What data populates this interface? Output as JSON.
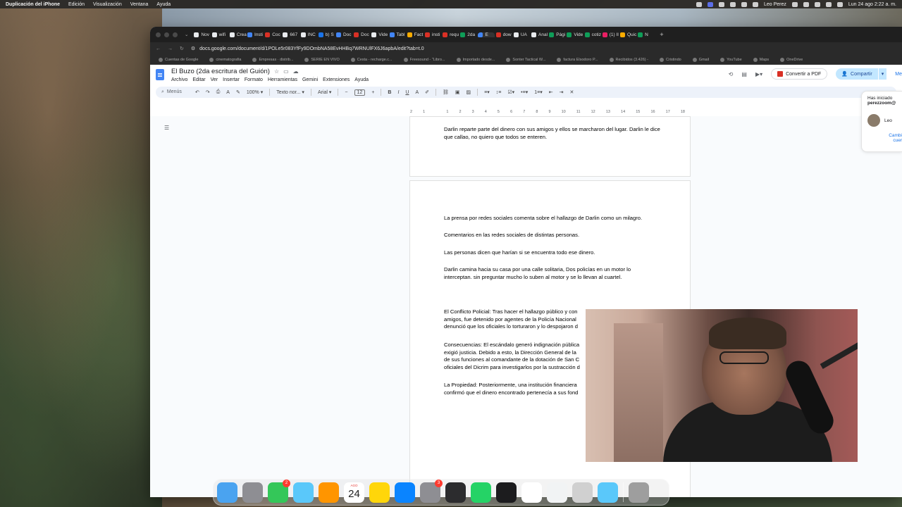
{
  "menubar": {
    "app": "Duplicación del iPhone",
    "items": [
      "Edición",
      "Visualización",
      "Ventana",
      "Ayuda"
    ],
    "user": "Leo Perez",
    "datetime": "Lun 24 ago 2:22 a. m."
  },
  "browser": {
    "tabs": [
      {
        "label": "Nov",
        "color": "#e8eaed"
      },
      {
        "label": "wifi",
        "color": "#e8eaed"
      },
      {
        "label": "Crea",
        "color": "#e8eaed"
      },
      {
        "label": "Insti",
        "color": "#4285f4"
      },
      {
        "label": "Coc",
        "color": "#d93025"
      },
      {
        "label": "667",
        "color": "#e8eaed"
      },
      {
        "label": "INC",
        "color": "#e8eaed"
      },
      {
        "label": "b) S",
        "color": "#1a73e8"
      },
      {
        "label": "Doc",
        "color": "#4285f4"
      },
      {
        "label": "Doc",
        "color": "#d93025"
      },
      {
        "label": "Vide",
        "color": "#e8eaed"
      },
      {
        "label": "Tabl",
        "color": "#4285f4"
      },
      {
        "label": "Fact",
        "color": "#f9ab00"
      },
      {
        "label": "insti",
        "color": "#d93025"
      },
      {
        "label": "requ",
        "color": "#d93025"
      },
      {
        "label": "2da",
        "color": "#0f9d58"
      },
      {
        "label": "E",
        "color": "#4285f4"
      },
      {
        "label": "dow",
        "color": "#d93025"
      },
      {
        "label": "UA",
        "color": "#e8eaed"
      },
      {
        "label": "Anal",
        "color": "#e8eaed"
      },
      {
        "label": "Pági",
        "color": "#0f9d58"
      },
      {
        "label": "Vide",
        "color": "#0f9d58"
      },
      {
        "label": "cotiz",
        "color": "#0f9d58"
      },
      {
        "label": "(1) Il",
        "color": "#e91e63"
      },
      {
        "label": "Quic",
        "color": "#f9ab00"
      },
      {
        "label": "N",
        "color": "#0f9d58"
      }
    ],
    "url": "docs.google.com/document/d/1POLe5r083YfFy9DOmbNA58EvHHBq7WRNUlFX6J6apbA/edit?tab=t.0",
    "bookmarks": [
      "Cuentas de Google",
      "cinematografia",
      "Empresas · distrib...",
      "SERIE EN VIVO",
      "Cesta - recharge.c...",
      "Freesound - \"Libro...",
      "Importado desde...",
      "Sonter Tactical W...",
      "factura Elsodoro P...",
      "Recibidos (3.426) -",
      "Cristindo",
      "Gmail",
      "YouTube",
      "Maps",
      "OneDrive"
    ]
  },
  "docs": {
    "title": "El Buzo (2da escritura del Guión)",
    "menus": [
      "Archivo",
      "Editar",
      "Ver",
      "Insertar",
      "Formato",
      "Herramientas",
      "Gemini",
      "Extensiones",
      "Ayuda"
    ],
    "pdf_button": "Convertir a PDF",
    "share_button": "Compartir",
    "share_tail": "Me",
    "toolbar": {
      "search": "Menús",
      "zoom": "100%",
      "style": "Texto nor...",
      "font": "Arial",
      "size": "12"
    },
    "ruler": [
      "2",
      "1",
      "",
      "1",
      "2",
      "3",
      "4",
      "5",
      "6",
      "7",
      "8",
      "9",
      "10",
      "11",
      "12",
      "13",
      "14",
      "15",
      "16",
      "17",
      "18"
    ],
    "page1_paragraphs": [
      "Darlin reparte parte del dinero con sus amigos y ellos se marcharon del lugar. Darlin le dice que callao, no quiero que todos se enteren."
    ],
    "page2_paragraphs": [
      "La prensa por redes sociales comenta sobre el hallazgo de Darlin como un milagro.",
      "Comentarios en las redes sociales  de distintas personas.",
      "Las personas dicen que harían si se encuentra todo ese dinero.",
      "Darlin camina hacia su casa por una calle solitaria, Dos policías en un motor lo interceptan. sin preguntar mucho lo suben al motor y se lo llevan al cuartel.",
      "El Conflicto Policial: Tras hacer el hallazgo público y con",
      "amigos, fue detenido por agentes de la Policía Nacional",
      "denunció que los oficiales lo torturaron y lo despojaron d",
      "Consecuencias: El escándalo generó indignación pública",
      "exigió justicia. Debido a esto, la Dirección General de la",
      "de sus funciones al comandante de la dotación de San C",
      "oficiales del Dicrim para investigarlos por la sustracción d",
      "La Propiedad: Posteriormente, una institución financiera",
      "confirmó que el dinero encontrado pertenecía a sus fond"
    ],
    "side_panel": {
      "line1": "Has iniciado",
      "email": "perezzoom@",
      "user": "Leo",
      "link1": "Cambi",
      "link2": "cuer"
    }
  },
  "dock": {
    "apps": [
      {
        "name": "finder",
        "color": "#4aa3f0",
        "badge": ""
      },
      {
        "name": "launchpad",
        "color": "#8e8e93",
        "badge": ""
      },
      {
        "name": "messages",
        "color": "#34c759",
        "badge": "2"
      },
      {
        "name": "maps",
        "color": "#5ac8fa",
        "badge": ""
      },
      {
        "name": "photos",
        "color": "#ff9500",
        "badge": ""
      },
      {
        "name": "calendar",
        "color": "#ffffff",
        "badge": ""
      },
      {
        "name": "notes",
        "color": "#ffd60a",
        "badge": ""
      },
      {
        "name": "app-store",
        "color": "#0a84ff",
        "badge": ""
      },
      {
        "name": "system-settings",
        "color": "#8e8e93",
        "badge": "3"
      },
      {
        "name": "davinci-resolve",
        "color": "#2c2c2e",
        "badge": ""
      },
      {
        "name": "whatsapp",
        "color": "#25d366",
        "badge": ""
      },
      {
        "name": "obs",
        "color": "#1c1c1e",
        "badge": ""
      },
      {
        "name": "docs-app",
        "color": "#ffffff",
        "badge": ""
      },
      {
        "name": "chrome",
        "color": "#f1f3f4",
        "badge": ""
      },
      {
        "name": "iphone-mirroring",
        "color": "#d0d0d0",
        "badge": ""
      },
      {
        "name": "quicktime",
        "color": "#5ac8fa",
        "badge": ""
      },
      {
        "name": "trash",
        "color": "#9e9e9e",
        "badge": ""
      }
    ],
    "calendar_month": "AGO",
    "calendar_day": "24"
  }
}
